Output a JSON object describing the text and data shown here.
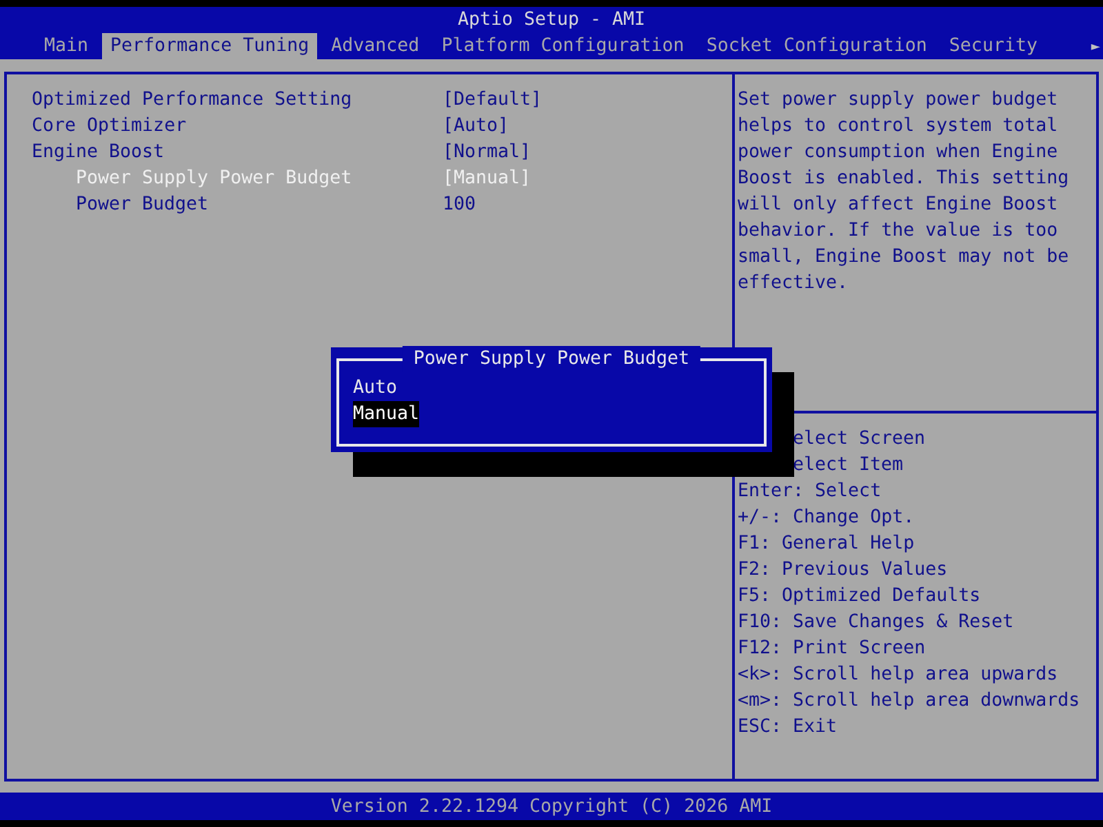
{
  "window": {
    "title": "Aptio Setup - AMI"
  },
  "tabs": [
    {
      "label": "Main",
      "selected": false
    },
    {
      "label": "Performance Tuning",
      "selected": true
    },
    {
      "label": "Advanced",
      "selected": false
    },
    {
      "label": "Platform Configuration",
      "selected": false
    },
    {
      "label": "Socket Configuration",
      "selected": false
    },
    {
      "label": "Security",
      "selected": false
    }
  ],
  "more_tabs_arrow": "►",
  "settings": [
    {
      "label": "Optimized Performance Setting",
      "value": "[Default]",
      "selected": false
    },
    {
      "label": "Core Optimizer",
      "value": "[Auto]",
      "selected": false
    },
    {
      "label": "Engine Boost",
      "value": "[Normal]",
      "selected": false,
      "children": [
        {
          "label": "Power Supply Power Budget",
          "value": "[Manual]",
          "selected": true
        },
        {
          "label": "Power Budget",
          "value": "100",
          "selected": false
        }
      ]
    }
  ],
  "help": {
    "text": "Set power supply power budget helps to control system total power consumption when Engine Boost is enabled. This setting will only affect Engine Boost behavior. If the value is too small, Engine Boost may not be effective.",
    "keys_behind_popup": [
      "elect Screen",
      "elect Item"
    ],
    "keys": [
      "Enter: Select",
      "+/-: Change Opt.",
      "F1: General Help",
      "F2: Previous Values",
      "F5: Optimized Defaults",
      "F10: Save Changes & Reset",
      "F12: Print Screen",
      "<k>: Scroll help area upwards",
      "<m>: Scroll help area downwards",
      "ESC: Exit"
    ]
  },
  "popup": {
    "title": "Power Supply Power Budget",
    "options": [
      {
        "label": "Auto",
        "selected": false
      },
      {
        "label": "Manual",
        "selected": true
      }
    ]
  },
  "footer": "Version 2.22.1294 Copyright (C) 2026 AMI"
}
